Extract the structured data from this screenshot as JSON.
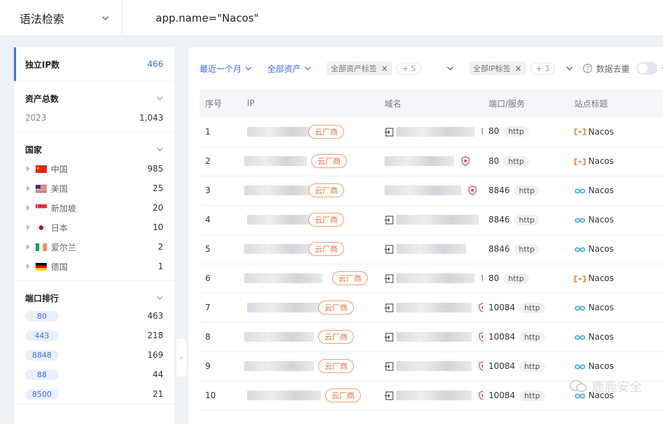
{
  "topbar": {
    "mode_label": "语法检索",
    "query": "app.name=\"Nacos\""
  },
  "sidebar": {
    "unique_ip": {
      "label": "独立IP数",
      "value": "466"
    },
    "assets": {
      "label": "资产总数",
      "rows": [
        {
          "label": "2023",
          "value": "1,043"
        }
      ]
    },
    "country": {
      "label": "国家",
      "items": [
        {
          "name": "中国",
          "count": "985",
          "flag": "cn"
        },
        {
          "name": "美国",
          "count": "25",
          "flag": "us"
        },
        {
          "name": "新加坡",
          "count": "20",
          "flag": "sg"
        },
        {
          "name": "日本",
          "count": "10",
          "flag": "jp"
        },
        {
          "name": "爱尔兰",
          "count": "2",
          "flag": "ie"
        },
        {
          "name": "德国",
          "count": "1",
          "flag": "de"
        }
      ]
    },
    "ports": {
      "label": "端口排行",
      "items": [
        {
          "port": "80",
          "count": "463"
        },
        {
          "port": "443",
          "count": "218"
        },
        {
          "port": "8848",
          "count": "169"
        },
        {
          "port": "88",
          "count": "44"
        },
        {
          "port": "8500",
          "count": "21"
        }
      ]
    }
  },
  "filters": {
    "time": "最近一个月",
    "asset_scope": "全部资产",
    "asset_tags": "全部资产标签",
    "asset_tags_more": "+ 5",
    "ip_tags": "全部IP标签",
    "ip_tags_more": "+ 3",
    "dedup": "数据去重",
    "toggle": "否"
  },
  "table": {
    "headers": [
      "序号",
      "IP",
      "域名",
      "端口/服务",
      "站点标题"
    ],
    "cloud_label": "云厂商",
    "rows": [
      {
        "no": "1",
        "port": "80",
        "svc": "http",
        "title": "Nacos",
        "icon": "orange"
      },
      {
        "no": "2",
        "port": "80",
        "svc": "http",
        "title": "Nacos",
        "icon": "orange"
      },
      {
        "no": "3",
        "port": "8846",
        "svc": "http",
        "title": "Nacos",
        "icon": "blue"
      },
      {
        "no": "4",
        "port": "8846",
        "svc": "http",
        "title": "Nacos",
        "icon": "blue"
      },
      {
        "no": "5",
        "port": "8846",
        "svc": "http",
        "title": "Nacos",
        "icon": "blue"
      },
      {
        "no": "6",
        "port": "80",
        "svc": "http",
        "title": "Nacos",
        "icon": "orange"
      },
      {
        "no": "7",
        "port": "10084",
        "svc": "http",
        "title": "Nacos",
        "icon": "blue"
      },
      {
        "no": "8",
        "port": "10084",
        "svc": "http",
        "title": "Nacos",
        "icon": "blue"
      },
      {
        "no": "9",
        "port": "10084",
        "svc": "http",
        "title": "Nacos",
        "icon": "blue"
      },
      {
        "no": "10",
        "port": "10084",
        "svc": "http",
        "title": "Nacos",
        "icon": "blue"
      }
    ]
  },
  "watermark": "鹿鹿安全",
  "colors": {
    "accent": "#3d6ef6",
    "cloud": "#e2743f",
    "shield": "#e0435a"
  }
}
